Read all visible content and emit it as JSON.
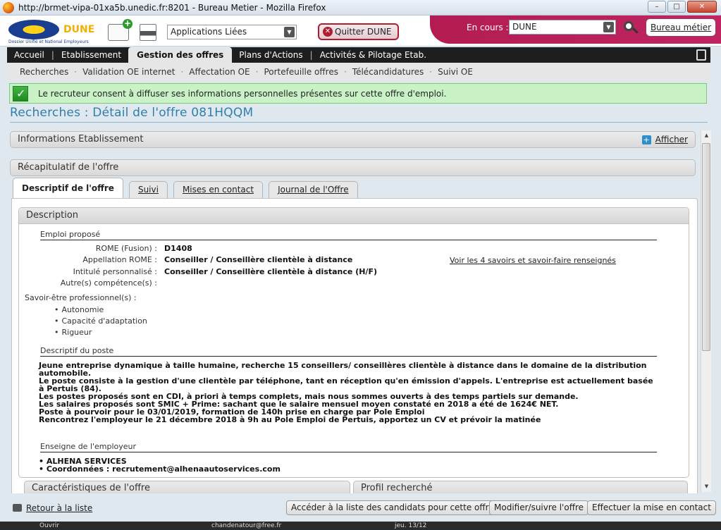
{
  "window": {
    "title": "http://brmet-vipa-01xa5b.unedic.fr:8201 - Bureau Metier - Mozilla Firefox",
    "buttons": [
      "–",
      "□",
      "✕"
    ]
  },
  "header": {
    "logo_text": "DUNE",
    "logo_subtitle": "Dossier Unifié et National Employeurs",
    "apps_select": "Applications Liées",
    "quit_label": "Quitter DUNE",
    "current_label": "En cours :",
    "current_value": "DUNE",
    "bureau_label": "Bureau métier"
  },
  "mainnav": {
    "items": [
      "Accueil",
      "Etablissement",
      "Gestion des offres",
      "Plans d'Actions",
      "Activités & Pilotage Etab."
    ],
    "active": "Gestion des offres"
  },
  "subnav": {
    "items": [
      "Recherches",
      "Validation OE internet",
      "Affectation OE",
      "Portefeuille offres",
      "Télécandidatures",
      "Suivi OE"
    ]
  },
  "notice": "Le recruteur consent à diffuser ses informations personnelles présentes sur cette offre d'emploi.",
  "page_title": "Recherches : Détail de l'offre 081HQQM",
  "panels": {
    "info": "Informations Etablissement",
    "afficher": "Afficher",
    "recap": "Récapitulatif de l'offre"
  },
  "tabs": [
    "Descriptif de l'offre",
    "Suivi",
    "Mises en contact",
    "Journal de l'Offre"
  ],
  "description": {
    "head": "Description",
    "emploi_title": "Emploi proposé",
    "fields": [
      {
        "label": "ROME (Fusion) :",
        "value": "D1408"
      },
      {
        "label": "Appellation ROME :",
        "value": "Conseiller / Conseillère clientèle à distance"
      },
      {
        "label": "Intitulé personnalisé :",
        "value": "Conseiller / Conseillère clientèle à distance (H/F)"
      },
      {
        "label": "Autre(s) compétence(s) :",
        "value": ""
      },
      {
        "label": "Savoir-être professionnel(s) :",
        "value": ""
      }
    ],
    "savoir_link": "Voir les 4 savoirs et savoir-faire renseignés",
    "savoir_etre": [
      "Autonomie",
      "Capacité d'adaptation",
      "Rigueur"
    ],
    "poste_title": "Descriptif du poste",
    "poste_lines": [
      "Jeune entreprise dynamique à taille humaine, recherche 15 conseillers/ conseillères clientèle à distance dans le domaine de la distribution automobile.",
      "Le poste consiste à la gestion d'une clientèle par téléphone, tant en réception qu'en émission d'appels. L'entreprise est actuellement basée à Pertuis (84).",
      "Les postes proposés sont en CDI, à priori à temps complets, mais nous sommes ouverts à des temps partiels sur demande.",
      "Les salaires proposés sont SMIC + Prime: sachant que le salaire mensuel moyen constaté en 2018 a été de 1624€ NET.",
      "Poste à pourvoir pour le 03/01/2019, formation de 140h prise en charge par Pole Emploi",
      "Rencontrez l'employeur le 21 décembre 2018 à 9h au Pole Emploi de Pertuis, apportez un CV et prévoir la matinée"
    ],
    "enseigne_title": "Enseigne de l'employeur",
    "enseigne_lines": [
      "• ALHENA SERVICES",
      "• Coordonnées : recrutement@alhenaautoservices.com"
    ]
  },
  "lower_panels": [
    "Caractéristiques de l'offre",
    "Profil recherché"
  ],
  "footer": {
    "back": "Retour à la liste",
    "buttons": [
      "Accéder à la liste des candidats pour cette offre",
      "Modifier/suivre l'offre",
      "Effectuer la mise en contact"
    ]
  },
  "taskbar": [
    "Ouvrir",
    "chandenatour@free.fr",
    "jeu. 13/12"
  ]
}
